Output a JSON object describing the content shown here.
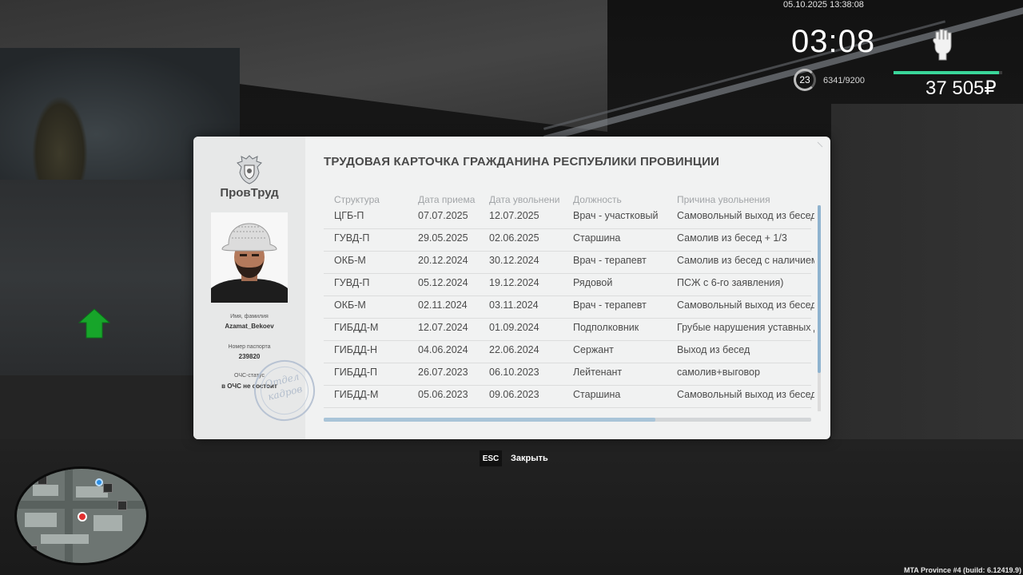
{
  "hud": {
    "datetime": "05.10.2025 13:38:08",
    "clock": "03:08",
    "level": "23",
    "experience": "6341/9200",
    "money": "37 505₽",
    "health_fraction": 0.97,
    "fist_icon": "fist-icon"
  },
  "dialog": {
    "brand": "ПровТруд",
    "title": "ТРУДОВАЯ КАРТОЧКА ГРАЖДАНИНА РЕСПУБЛИКИ ПРОВИНЦИИ",
    "name_label": "Имя, фамилия",
    "name_value": "Azamat_Bekoev",
    "passport_label": "Номер паспорта",
    "passport_value": "239820",
    "ochs_label": "ОЧС-статус",
    "ochs_value": "в ОЧС не состоит",
    "stamp_line1": "Отдел",
    "stamp_line2": "кадров",
    "columns": [
      "Структура",
      "Дата приема",
      "Дата увольнени",
      "Должность",
      "Причина увольнения"
    ],
    "rows": [
      [
        "ЦГБ-П",
        "07.07.2025",
        "12.07.2025",
        "Врач - участковый",
        "Самовольный выход из бесед"
      ],
      [
        "ГУВД-П",
        "29.05.2025",
        "02.06.2025",
        "Старшина",
        "Самолив из бесед + 1/3"
      ],
      [
        "ОКБ-М",
        "20.12.2024",
        "30.12.2024",
        "Врач - терапевт",
        "Самолив из бесед с наличием"
      ],
      [
        "ГУВД-П",
        "05.12.2024",
        "19.12.2024",
        "Рядовой",
        "ПСЖ с 6-го заявления)"
      ],
      [
        "ОКБ-М",
        "02.11.2024",
        "03.11.2024",
        "Врач - терапевт",
        "Самовольный выход из бесед"
      ],
      [
        "ГИБДД-М",
        "12.07.2024",
        "01.09.2024",
        "Подполковник",
        "Грубые нарушения уставных д"
      ],
      [
        "ГИБДД-Н",
        "04.06.2024",
        "22.06.2024",
        "Сержант",
        "Выход из бесед"
      ],
      [
        "ГИБДД-П",
        "26.07.2023",
        "06.10.2023",
        "Лейтенант",
        "самолив+выговор"
      ],
      [
        "ГИБДД-М",
        "05.06.2023",
        "09.06.2023",
        "Старшина",
        "Самовольный выход из бесед"
      ]
    ],
    "hscroll_fraction": 0.68
  },
  "close_hint": {
    "key": "ESC",
    "label": "Закрыть"
  },
  "build_info": "MTA Province #4 (build: 6.12419.9)"
}
